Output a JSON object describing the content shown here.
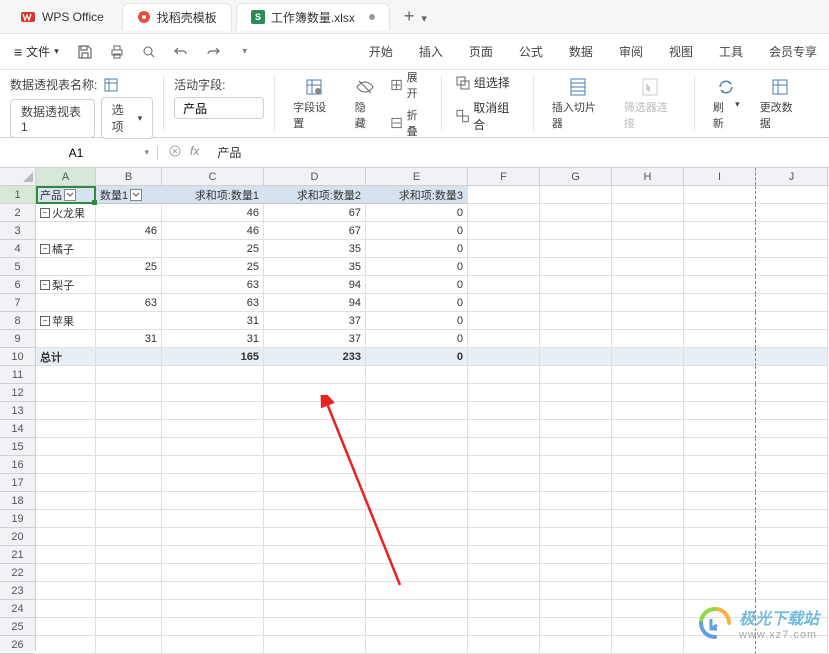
{
  "app": {
    "name": "WPS Office"
  },
  "tabs": {
    "template": {
      "label": "找稻壳模板"
    },
    "doc": {
      "label": "工作簿数量.xlsx"
    },
    "plus": "+"
  },
  "menubar": {
    "hamburger": "≡",
    "file": "文件",
    "items": [
      "开始",
      "插入",
      "页面",
      "公式",
      "数据",
      "审阅",
      "视图",
      "工具",
      "会员专享"
    ]
  },
  "ribbon": {
    "pivot_name_label": "数据透视表名称:",
    "pivot_name_value": "数据透视表1",
    "options_btn": "选项",
    "active_field_label": "活动字段:",
    "active_field_value": "产品",
    "field_settings": "字段设置",
    "hide": "隐藏",
    "expand": "展开",
    "collapse": "折叠",
    "group_select": "组选择",
    "ungroup": "取消组合",
    "insert_slicer": "插入切片器",
    "filter_connect": "筛选器连接",
    "refresh": "刷新",
    "change_data": "更改数据"
  },
  "namebox": {
    "value": "A1"
  },
  "formula": {
    "fx": "fx",
    "value": "产品"
  },
  "columns": [
    "A",
    "B",
    "C",
    "D",
    "E",
    "F",
    "G",
    "H",
    "I",
    "J"
  ],
  "rows_count": 26,
  "pivot": {
    "headers": {
      "c0": "产品",
      "c1": "数量1",
      "c2": "求和项:数量1",
      "c3": "求和项:数量2",
      "c4": "求和项:数量3"
    },
    "data": [
      {
        "label": "火龙果",
        "indent": true,
        "b": "",
        "c": "46",
        "d": "67",
        "e": "0"
      },
      {
        "label": "",
        "indent": false,
        "b": "46",
        "c": "46",
        "d": "67",
        "e": "0"
      },
      {
        "label": "橘子",
        "indent": true,
        "b": "",
        "c": "25",
        "d": "35",
        "e": "0"
      },
      {
        "label": "",
        "indent": false,
        "b": "25",
        "c": "25",
        "d": "35",
        "e": "0"
      },
      {
        "label": "梨子",
        "indent": true,
        "b": "",
        "c": "63",
        "d": "94",
        "e": "0"
      },
      {
        "label": "",
        "indent": false,
        "b": "63",
        "c": "63",
        "d": "94",
        "e": "0"
      },
      {
        "label": "苹果",
        "indent": true,
        "b": "",
        "c": "31",
        "d": "37",
        "e": "0"
      },
      {
        "label": "",
        "indent": false,
        "b": "31",
        "c": "31",
        "d": "37",
        "e": "0"
      }
    ],
    "total": {
      "label": "总计",
      "c": "165",
      "d": "233",
      "e": "0"
    }
  },
  "watermark": {
    "brand": "极光下载站",
    "url": "www.xz7.com"
  }
}
